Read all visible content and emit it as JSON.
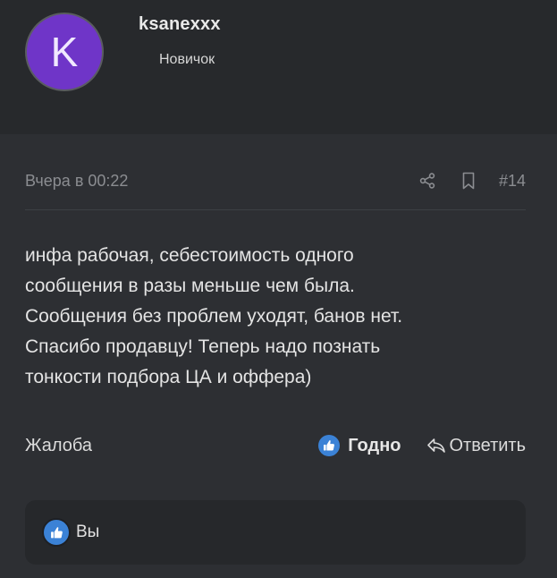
{
  "author": {
    "avatar_letter": "K",
    "avatar_color": "#6f35c8",
    "username": "ksanexxx",
    "role": "Новичок"
  },
  "post": {
    "date": "Вчера в 00:22",
    "number": "#14",
    "icons": [
      "share-icon",
      "bookmark-icon"
    ],
    "content": "инфа рабочая, себестоимость одного\nсообщения в разы меньше чем была.\nСообщения без проблем уходят, банов нет.\nСпасибо продавцу! Теперь надо познать\nтонкости подбора ЦА и оффера)",
    "actions": {
      "report_label": "Жалоба",
      "like_label": "Годно",
      "reply_label": "Ответить"
    },
    "reactions": {
      "text": "Вы"
    }
  },
  "colors": {
    "page_bg": "#2a2c2f",
    "accent_blue": "#3b82d6",
    "muted_text": "#8b8d91"
  }
}
